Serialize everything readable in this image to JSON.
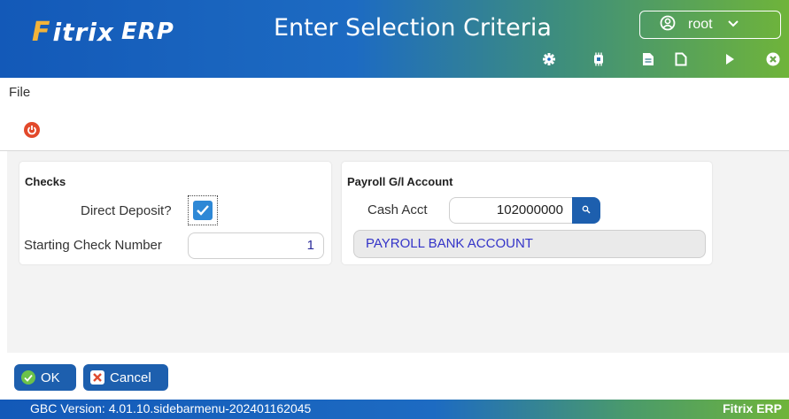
{
  "header": {
    "logo_mark": "F",
    "logo_name": "itrix",
    "logo_erp": "ERP",
    "title": "Enter Selection Criteria",
    "user": "root"
  },
  "toolbar": {
    "icons": [
      "gear-icon",
      "chip-icon",
      "document-icon",
      "new-document-icon",
      "play-icon",
      "close-icon"
    ]
  },
  "menu": {
    "file": "File"
  },
  "checks_panel": {
    "title": "Checks",
    "direct_deposit_label": "Direct Deposit?",
    "direct_deposit_checked": true,
    "starting_check_label": "Starting Check Number",
    "starting_check_value": "1"
  },
  "payroll_panel": {
    "title": "Payroll G/l Account",
    "cash_acct_label": "Cash Acct",
    "cash_acct_value": "102000000",
    "account_description": "PAYROLL BANK ACCOUNT"
  },
  "buttons": {
    "ok": "OK",
    "cancel": "Cancel"
  },
  "status": {
    "version": "GBC Version: 4.01.10.sidebarmenu-202401162045",
    "brand": "Fitrix ERP"
  },
  "colors": {
    "accent": "#1d5fae",
    "check_blue": "#2e88d6",
    "power_red": "#e2492b",
    "ok_green": "#6cc24a",
    "cancel_red": "#e04a2f",
    "brand_orange": "#f2b33a"
  }
}
